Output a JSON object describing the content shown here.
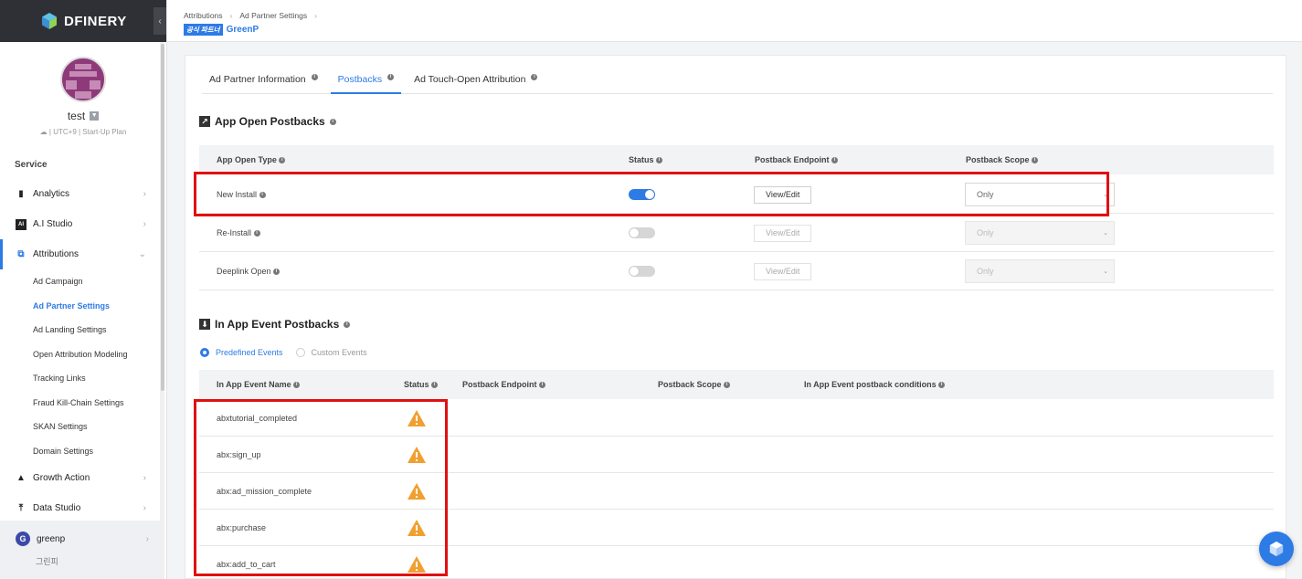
{
  "app": {
    "logo_text": "DFINERY"
  },
  "user": {
    "name": "test",
    "meta": "UTC+9 | Start-Up Plan"
  },
  "sidebar": {
    "section_label": "Service",
    "items": [
      {
        "label": "Analytics",
        "icon": "bar-chart-icon"
      },
      {
        "label": "A.I Studio",
        "icon": "ai-icon"
      },
      {
        "label": "Attributions",
        "icon": "attributions-icon"
      },
      {
        "label": "Growth Action",
        "icon": "growth-icon"
      },
      {
        "label": "Data Studio",
        "icon": "upload-icon"
      }
    ],
    "sub_items": [
      "Ad Campaign",
      "Ad Partner Settings",
      "Ad Landing Settings",
      "Open Attribution Modeling",
      "Tracking Links",
      "Fraud Kill-Chain Settings",
      "SKAN Settings",
      "Domain Settings"
    ],
    "org": {
      "initial": "G",
      "name": "greenp",
      "sub": "그린피"
    }
  },
  "header": {
    "breadcrumb": [
      "Attributions",
      "Ad Partner Settings"
    ],
    "badge": "공식 파트너",
    "partner_name": "GreenP"
  },
  "tabs": [
    {
      "label": "Ad Partner Information"
    },
    {
      "label": "Postbacks"
    },
    {
      "label": "Ad Touch-Open Attribution"
    }
  ],
  "app_open": {
    "title": "App Open Postbacks",
    "columns": [
      "App Open Type",
      "Status",
      "Postback Endpoint",
      "Postback Scope"
    ],
    "rows": [
      {
        "type": "New Install",
        "status": true,
        "button": "View/Edit",
        "scope": "Only"
      },
      {
        "type": "Re-Install",
        "status": false,
        "button": "View/Edit",
        "scope": "Only"
      },
      {
        "type": "Deeplink Open",
        "status": false,
        "button": "View/Edit",
        "scope": "Only"
      }
    ]
  },
  "in_app": {
    "title": "In App Event Postbacks",
    "radio": {
      "predefined": "Predefined Events",
      "custom": "Custom Events"
    },
    "columns": [
      "In App Event Name",
      "Status",
      "Postback Endpoint",
      "Postback Scope",
      "In App Event postback conditions"
    ],
    "events": [
      "abxtutorial_completed",
      "abx:sign_up",
      "abx:ad_mission_complete",
      "abx:purchase",
      "abx:add_to_cart"
    ]
  },
  "colors": {
    "accent": "#2d7be5",
    "highlight": "#e01010",
    "warning": "#f0a030",
    "logo_bar": "#2f3035"
  }
}
